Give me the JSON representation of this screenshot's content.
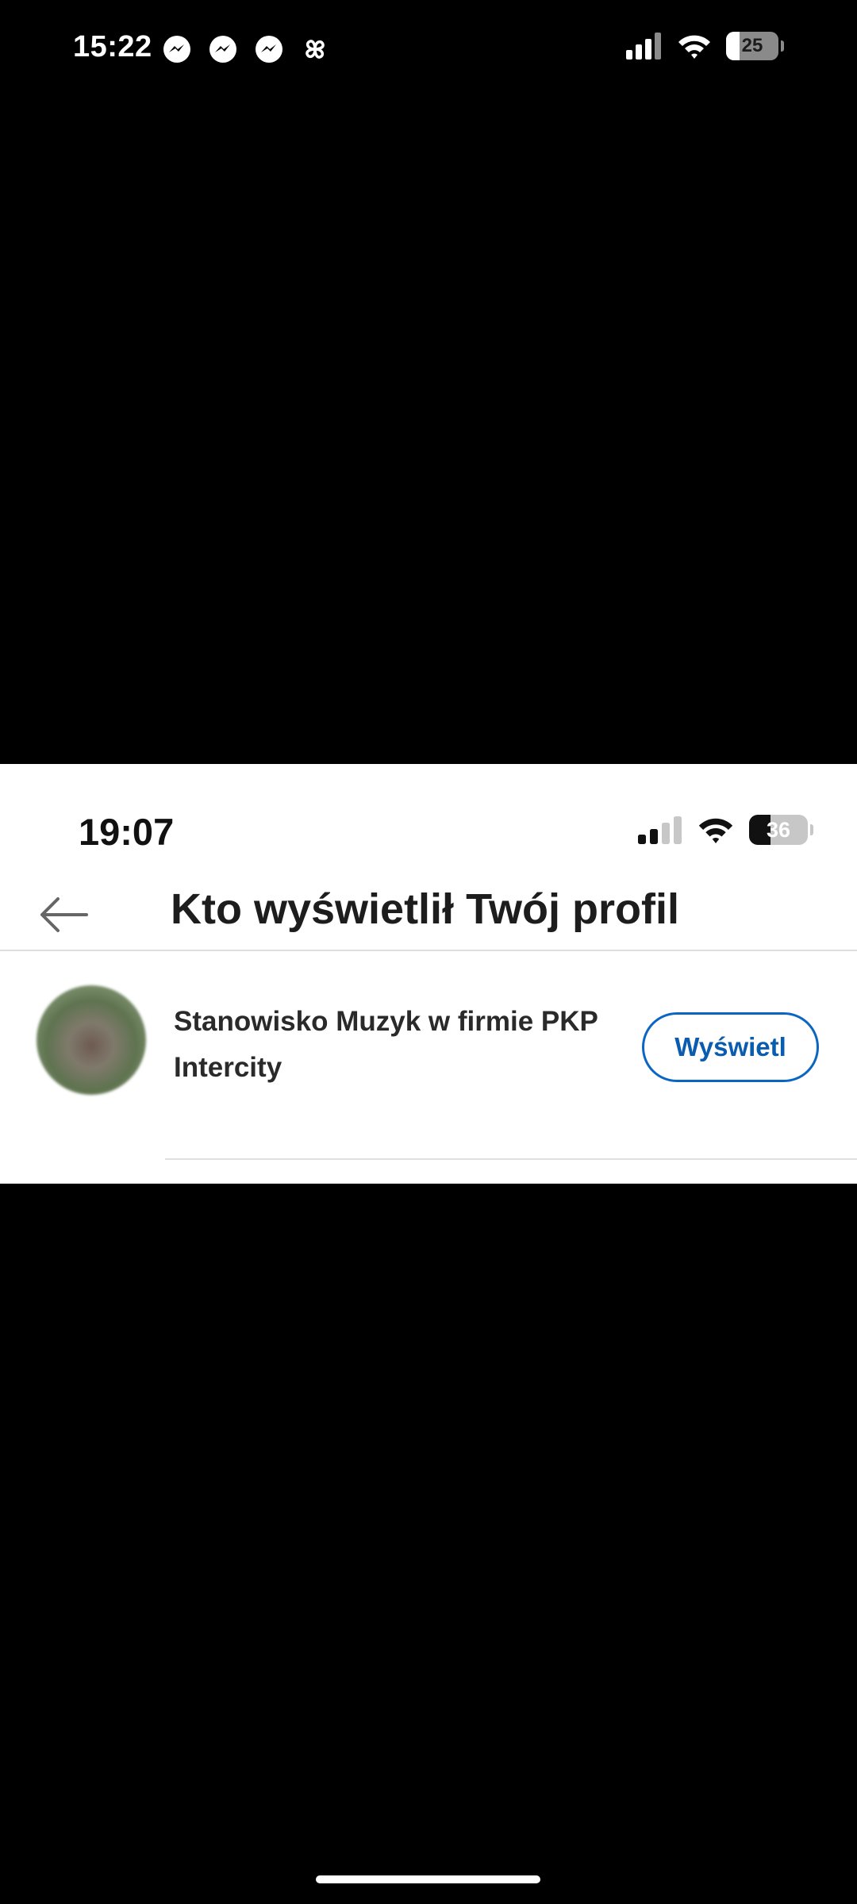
{
  "outer_status": {
    "time": "15:22",
    "notification_icons": [
      "messenger-icon",
      "messenger-icon",
      "messenger-icon",
      "pinwheel-icon"
    ],
    "battery_level": "25",
    "battery_fraction": 0.25
  },
  "inner_status": {
    "time": "19:07",
    "battery_level": "36",
    "battery_fraction": 0.36
  },
  "header": {
    "back_icon": "arrow-left-icon",
    "title": "Kto wyświetlił Twój profil"
  },
  "viewer": {
    "text": "Stanowisko Muzyk w firmie PKP Intercity",
    "button_label": "Wyświetl"
  },
  "colors": {
    "accent": "#0a66c2",
    "text": "#1d1d1d",
    "background": "#ffffff",
    "outer_background": "#000000"
  }
}
